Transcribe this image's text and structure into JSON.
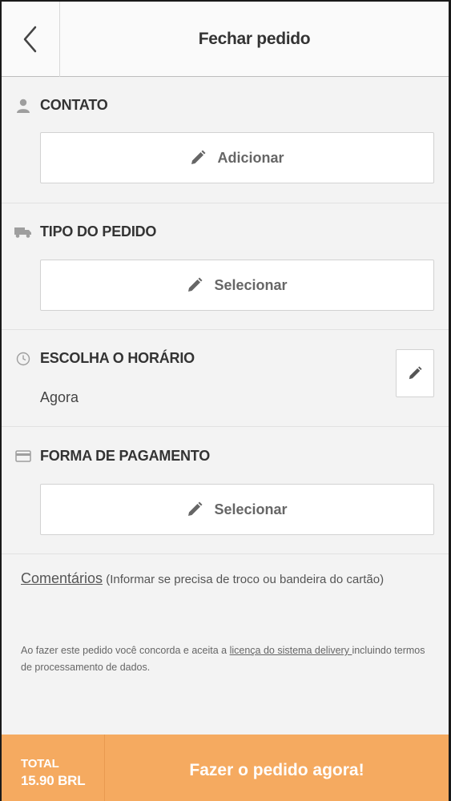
{
  "header": {
    "title": "Fechar pedido",
    "back_icon": "chevron-left-icon"
  },
  "sections": {
    "contact": {
      "title": "CONTATO",
      "icon": "user-icon",
      "button_label": "Adicionar"
    },
    "order_type": {
      "title": "TIPO DO PEDIDO",
      "icon": "truck-icon",
      "button_label": "Selecionar"
    },
    "time": {
      "title": "ESCOLHA O HORÁRIO",
      "icon": "clock-icon",
      "value": "Agora"
    },
    "payment": {
      "title": "FORMA DE PAGAMENTO",
      "icon": "credit-card-icon",
      "button_label": "Selecionar"
    }
  },
  "comments": {
    "link": "Comentários",
    "hint": "(Informar se precisa de troco ou bandeira do cartão)"
  },
  "legal": {
    "before": "Ao fazer este pedido você concorda e aceita a ",
    "link": "licença do sistema delivery ",
    "after": "incluindo termos de processamento de dados."
  },
  "footer": {
    "total_label": "TOTAL",
    "total_value": "15.90 BRL",
    "cta": "Fazer o pedido agora!"
  },
  "colors": {
    "accent": "#f5aa60",
    "background": "#f3f3f3",
    "icon_gray": "#9e9e9e"
  }
}
